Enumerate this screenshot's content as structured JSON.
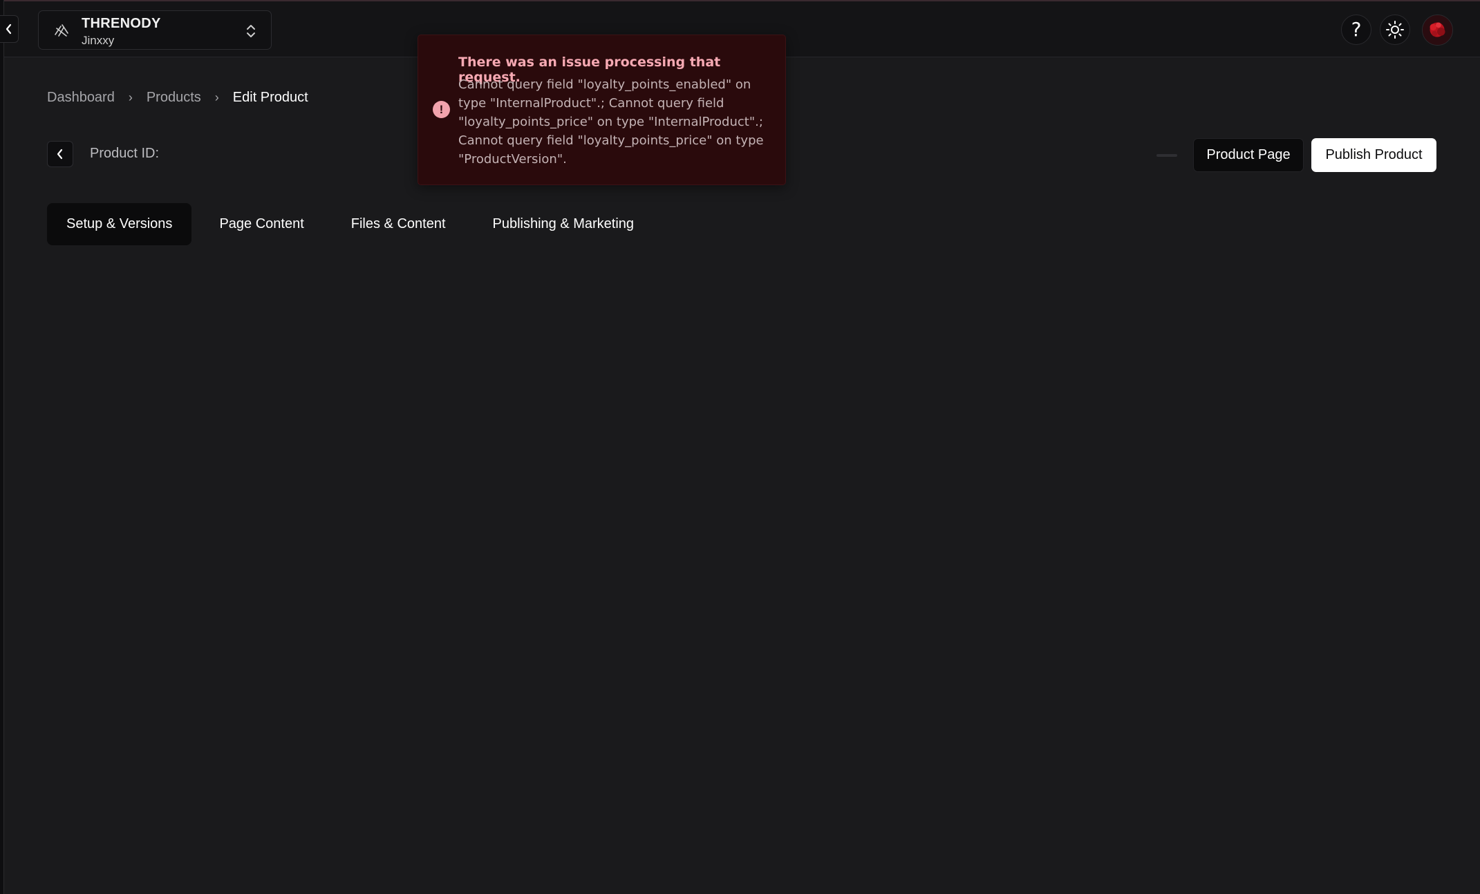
{
  "store": {
    "name": "THRENODY",
    "subtitle": "Jinxxy"
  },
  "breadcrumb": {
    "items": [
      "Dashboard",
      "Products",
      "Edit Product"
    ]
  },
  "product": {
    "id_label": "Product ID:"
  },
  "actions": {
    "product_page": "Product Page",
    "publish": "Publish Product"
  },
  "tabs": [
    {
      "label": "Setup & Versions",
      "active": true
    },
    {
      "label": "Page Content",
      "active": false
    },
    {
      "label": "Files & Content",
      "active": false
    },
    {
      "label": "Publishing & Marketing",
      "active": false
    }
  ],
  "toast": {
    "title": "There was an issue processing that request.",
    "message": "Cannot query field \"loyalty_points_enabled\" on type \"InternalProduct\".; Cannot query field \"loyalty_points_price\" on type \"InternalProduct\".; Cannot query field \"loyalty_points_price\" on type \"ProductVersion\".",
    "icon_glyph": "!"
  },
  "header": {
    "help_glyph": "?"
  },
  "colors": {
    "background": "#1a1a1c",
    "toast_bg": "#2a0a0c",
    "toast_title": "#f7a9b3",
    "publish_bg": "#ffffff"
  },
  "icons": [
    "chevron-left-icon",
    "store-logo-icon",
    "chevron-up-down-icon",
    "help-icon",
    "sun-icon",
    "avatar",
    "error-icon"
  ]
}
